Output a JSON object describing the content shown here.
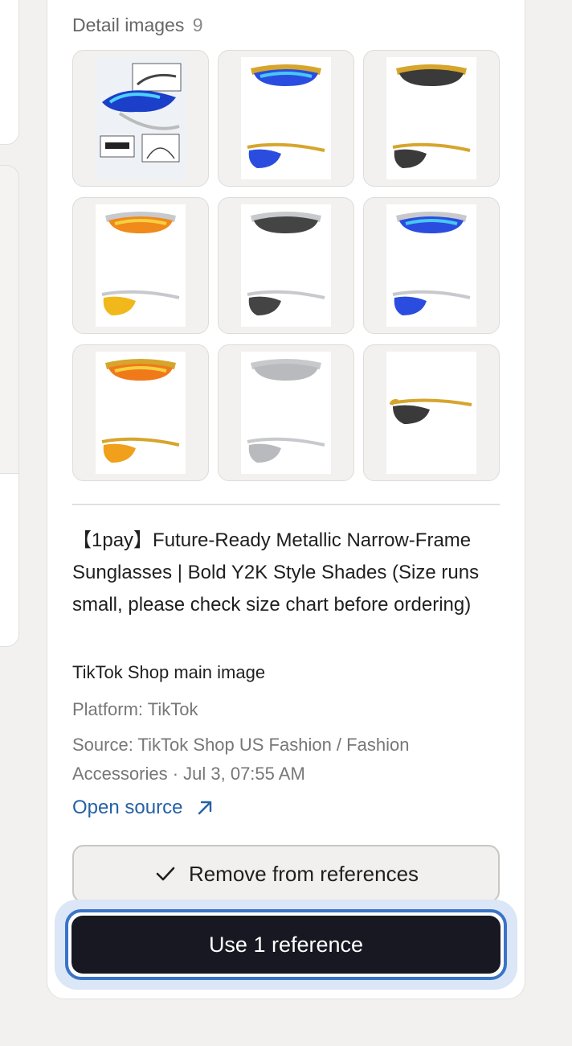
{
  "detail_images": {
    "title": "Detail images",
    "count": "9",
    "items": [
      {
        "icon": "sunglasses-infographic-image"
      },
      {
        "icon": "sunglasses-gold-blue-lens-image"
      },
      {
        "icon": "sunglasses-gold-smoke-lens-image"
      },
      {
        "icon": "sunglasses-silver-fire-lens-image"
      },
      {
        "icon": "sunglasses-silver-smoke-lens-image"
      },
      {
        "icon": "sunglasses-silver-blue-lens-image"
      },
      {
        "icon": "sunglasses-gold-fire-lens-image"
      },
      {
        "icon": "sunglasses-silver-mirror-lens-image"
      },
      {
        "icon": "sunglasses-gold-side-view-image"
      }
    ]
  },
  "product": {
    "title": "【1pay】Future-Ready Metallic Narrow-Frame Sunglasses | Bold Y2K Style Shades (Size runs small, please check size chart before ordering)",
    "subtitle": "TikTok Shop main image",
    "platform": "Platform: TikTok",
    "source": "Source: TikTok Shop US Fashion / Fashion Accessories · Jul 3, 07:55 AM",
    "open_source_label": "Open source"
  },
  "actions": {
    "remove_label": "Remove from references",
    "use_label": "Use 1 reference"
  },
  "colors": {
    "accent_blue": "#3b74c7",
    "link_blue": "#2561a6",
    "dark_button": "#171821"
  }
}
